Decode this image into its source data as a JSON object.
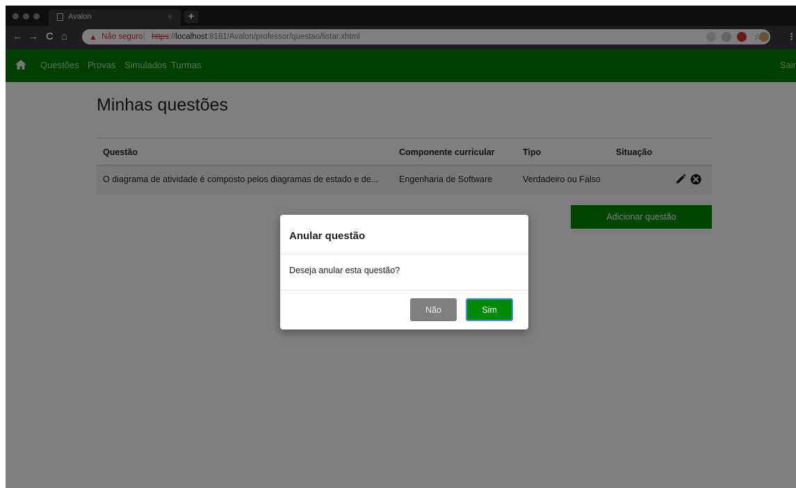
{
  "browser": {
    "tab_title": "Avalon",
    "tab_close": "×",
    "new_tab": "+",
    "nav": {
      "back": "←",
      "forward": "→",
      "reload": "C",
      "home": "⌂"
    },
    "address": {
      "security_label": "Não seguro",
      "separator": "|",
      "scheme": "https",
      "scheme_suffix": "://",
      "host": "localhost",
      "path": ":8181/Avalon/professor/questao/listar.xhtml"
    },
    "bookmark_icon": "☆",
    "menu_icon": "⋮",
    "colors": {
      "warning": "#d93025"
    }
  },
  "appnav": {
    "links": [
      "Questões",
      "Provas",
      "Simulados",
      "Turmas"
    ],
    "logout": "Sair",
    "color": "#007d00"
  },
  "page": {
    "title": "Minhas questões",
    "table": {
      "headers": [
        "Questão",
        "Componente curricular",
        "Tipo",
        "Situação"
      ],
      "rows": [
        {
          "questao": "O diagrama de atividade é composto pelos diagramas de estado e de...",
          "componente": "Engenharia de Software",
          "tipo": "Verdadeiro ou Falso",
          "situacao": ""
        }
      ]
    },
    "add_button": "Adicionar questão"
  },
  "modal": {
    "title": "Anular questão",
    "message": "Deseja anular esta questão?",
    "no_label": "Não",
    "yes_label": "Sim"
  }
}
